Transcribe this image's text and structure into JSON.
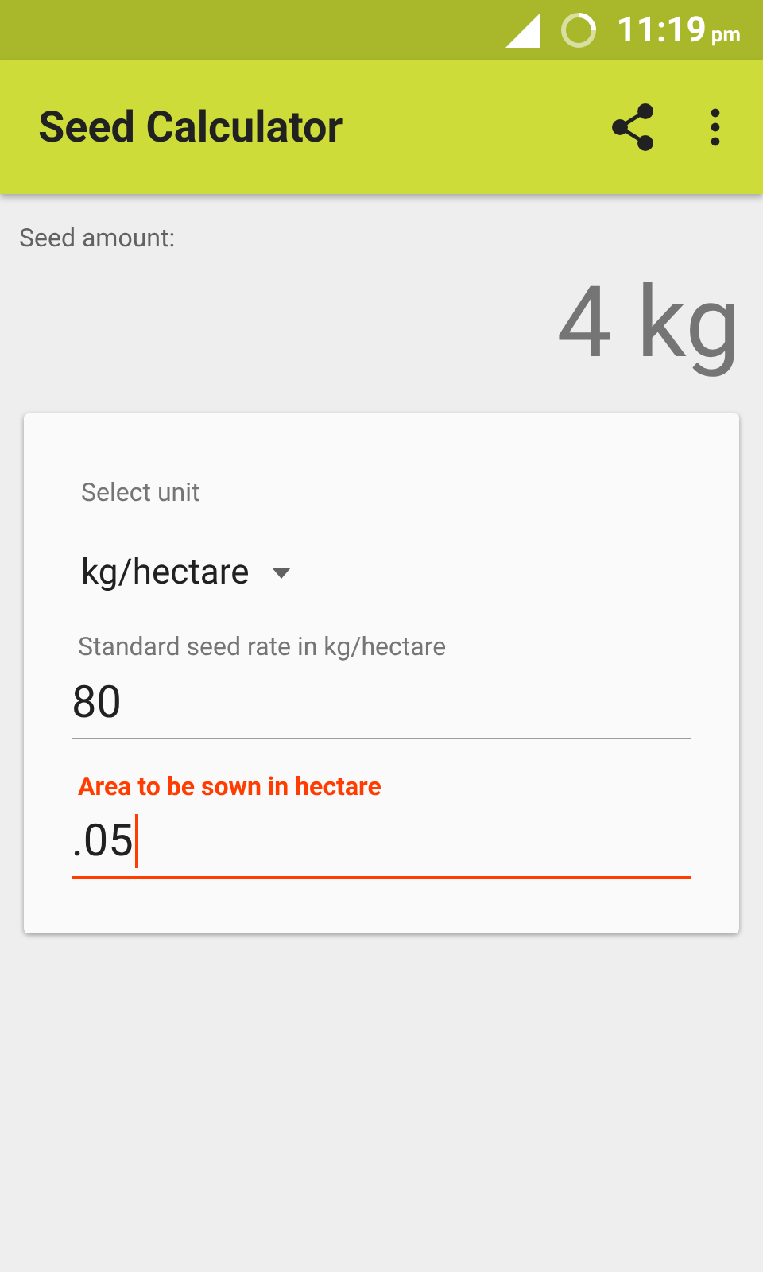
{
  "status_bar": {
    "time": "11:19",
    "period": "pm"
  },
  "app_bar": {
    "title": "Seed Calculator"
  },
  "result": {
    "label": "Seed amount:",
    "value": "4 kg"
  },
  "form": {
    "unit_label": "Select unit",
    "unit": "kg/hectare",
    "fields": [
      {
        "label": "Standard seed rate in kg/hectare",
        "value": "80",
        "focused": false
      },
      {
        "label": "Area to be sown in hectare",
        "value": ".05",
        "focused": true
      }
    ]
  }
}
